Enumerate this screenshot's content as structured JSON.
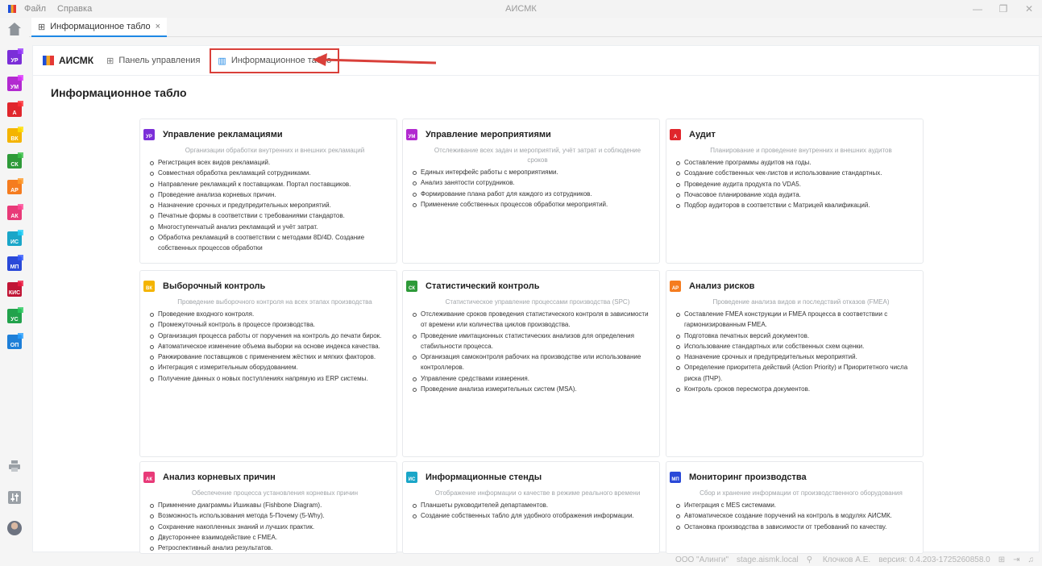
{
  "titlebar": {
    "menu": [
      "Файл",
      "Справка"
    ],
    "title": "АИСМК",
    "buttons": [
      "—",
      "❐",
      "✕"
    ]
  },
  "tab": {
    "label": "Информационное табло",
    "close": "×",
    "icon": "grid-icon"
  },
  "appnav": {
    "brand": "АИСМК",
    "control_panel": "Панель управления",
    "dashboard": "Информационное табло"
  },
  "page_title": "Информационное табло",
  "rail": {
    "modules": [
      {
        "code": "УР",
        "color": "#7b2ed8"
      },
      {
        "code": "УМ",
        "color": "#b22ad0"
      },
      {
        "code": "А",
        "color": "#e0262c"
      },
      {
        "code": "ВК",
        "color": "#f4b400"
      },
      {
        "code": "СК",
        "color": "#2e9a39"
      },
      {
        "code": "АР",
        "color": "#f57c1f"
      },
      {
        "code": "АК",
        "color": "#e83a78"
      },
      {
        "code": "ИС",
        "color": "#1aa6c8"
      },
      {
        "code": "МП",
        "color": "#2a49d8"
      },
      {
        "code": "КИС",
        "color": "#c01535"
      },
      {
        "code": "УС",
        "color": "#22a24c"
      },
      {
        "code": "ОП",
        "color": "#1e7fd8"
      }
    ],
    "tools": [
      "printer-icon",
      "sliders-icon"
    ]
  },
  "cards": [
    {
      "code": "УР",
      "color": "#7b2ed8",
      "title": "Управление рекламациями",
      "subtitle": "Организации обработки внутренних и внешних рекламаций",
      "items": [
        "Регистрация всех видов рекламаций.",
        "Совместная обработка рекламаций сотрудниками.",
        "Направление рекламаций к поставщикам. Портал поставщиков.",
        "Проведение анализа корневых причин.",
        "Назначение срочных и предупредительных мероприятий.",
        "Печатные формы в соответствии с требованиями стандартов.",
        "Многоступенчатый анализ рекламаций и учёт затрат.",
        "Обработка рекламаций в соответствии с методами 8D/4D. Создание собственных процессов обработки"
      ]
    },
    {
      "code": "УМ",
      "color": "#b22ad0",
      "title": "Управление мероприятиями",
      "subtitle": "Отслеживание всех задач и мероприятий, учёт затрат и соблюдение сроков",
      "items": [
        "Единых интерфейс работы с мероприятиями.",
        "Анализ занятости сотрудников.",
        "Формирование плана работ для каждого из сотрудников.",
        "Применение собственных процессов обработки мероприятий."
      ]
    },
    {
      "code": "А",
      "color": "#e0262c",
      "title": "Аудит",
      "subtitle": "Планирование и проведение внутренних и внешних аудитов",
      "items": [
        "Составление программы аудитов на годы.",
        "Создание собственных чек-листов и использование стандартных.",
        "Проведение аудита продукта по VDA5.",
        "Почасовое планирование хода аудита.",
        "Подбор аудиторов в соответствии с Матрицей квалификаций."
      ]
    },
    {
      "code": "ВК",
      "color": "#f4b400",
      "title": "Выборочный контроль",
      "subtitle": "Проведение выборочного контроля на всех этапах производства",
      "items": [
        "Проведение входного контроля.",
        "Промежуточный контроль в процессе производства.",
        "Организация процесса работы от поручения на контроль до печати бирок.",
        "Автоматическое изменение объема выборки на основе индекса качества.",
        "Ранжирование поставщиков с применением жёстких и мягких факторов.",
        "Интеграция с измерительным оборудованием.",
        "Получение данных о новых поступлениях напрямую из ERP системы."
      ]
    },
    {
      "code": "СК",
      "color": "#2e9a39",
      "title": "Статистический контроль",
      "subtitle": "Статистическое управление процессами производства (SPC)",
      "items": [
        "Отслеживание сроков проведения статистического контроля в зависимости от времени или количества циклов производства.",
        "Проведение имитационных статистических анализов для определения стабильности процесса.",
        "Организация самоконтроля рабочих на производстве или использование контроллеров.",
        "Управление средствами измерения.",
        "Проведение анализа измерительных систем (MSA)."
      ]
    },
    {
      "code": "АР",
      "color": "#f57c1f",
      "title": "Анализ рисков",
      "subtitle": "Проведение анализа видов и последствий отказов (FMEA)",
      "items": [
        "Составление FMEA конструкции и FMEA процесса в соответствии с гармонизированным FMEA.",
        "Подготовка печатных версий документов.",
        "Использование стандартных или собственных схем оценки.",
        "Назначение срочных и предупредительных мероприятий.",
        "Определение приоритета действий (Action Priority) и Приоритетного числа риска (ПЧР).",
        "Контроль сроков пересмотра документов."
      ]
    },
    {
      "code": "АК",
      "color": "#e83a78",
      "title": "Анализ корневых причин",
      "subtitle": "Обеспечение процесса установления корневых причин",
      "items": [
        "Применение диаграммы Ишикавы (Fishbone Diagram).",
        "Возможность использования метода 5-Почему (5-Why).",
        "Сохранение накопленных знаний и лучших практик.",
        "Двустороннее взаимодействие с FMEA.",
        "Ретроспективный анализ результатов."
      ]
    },
    {
      "code": "ИС",
      "color": "#1aa6c8",
      "title": "Информационные стенды",
      "subtitle": "Отображение информации о качестве в режиме реального времени",
      "items": [
        "Планшеты руководителей департаментов.",
        "Создание собственных табло для удобного отображения информации."
      ]
    },
    {
      "code": "МП",
      "color": "#2a49d8",
      "title": "Мониторинг производства",
      "subtitle": "Сбор и хранение информации от производственного оборудования",
      "items": [
        "Интеграция с MES системами.",
        "Автоматическое создание поручений на контроль в модулях АИСМК.",
        "Остановка производства в зависимости от требований по качеству."
      ]
    }
  ],
  "statusbar": {
    "company": "ООО \"Алинги\"",
    "host": "stage.aismk.local",
    "user": "Клочков А.Е.",
    "version": "версия: 0.4.203-1725260858.0"
  }
}
